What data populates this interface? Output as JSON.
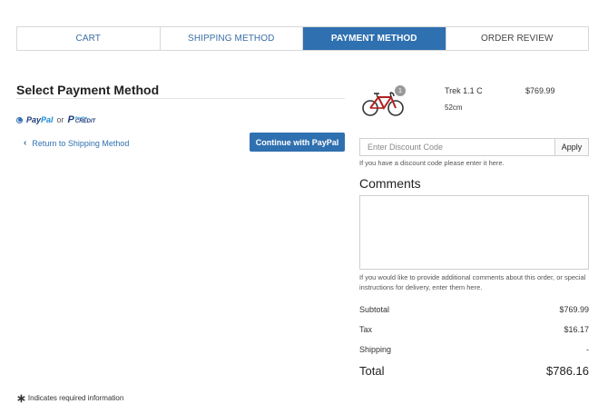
{
  "steps": [
    {
      "label": "CART",
      "active": false
    },
    {
      "label": "SHIPPING METHOD",
      "active": false
    },
    {
      "label": "PAYMENT METHOD",
      "active": true
    },
    {
      "label": "ORDER REVIEW",
      "active": false
    }
  ],
  "payment": {
    "title": "Select Payment Method",
    "option_paypal_pay": "Pay",
    "option_paypal_pal": "Pal",
    "or_text": "or",
    "credit_top": "PayPal",
    "credit_bottom": "CREDIT",
    "return_label": "Return to Shipping Method",
    "continue_label": "Continue with PayPal"
  },
  "required_note": "Indicates required information",
  "cart_item": {
    "quantity": "1",
    "name": "Trek 1.1 C",
    "variant": "52cm",
    "price": "$769.99",
    "image_icon": "bicycle-icon"
  },
  "discount": {
    "placeholder": "Enter Discount Code",
    "value": "",
    "apply_label": "Apply",
    "help": "If you have a discount code please enter it here."
  },
  "comments": {
    "title": "Comments",
    "value": "",
    "help": "If you would like to provide additional comments about this order, or special instructions for delivery, enter them here."
  },
  "summary": {
    "subtotal_label": "Subtotal",
    "subtotal_value": "$769.99",
    "tax_label": "Tax",
    "tax_value": "$16.17",
    "shipping_label": "Shipping",
    "shipping_value": "-",
    "total_label": "Total",
    "total_value": "$786.16"
  },
  "colors": {
    "accent": "#2f70b0",
    "link": "#3a6ea5",
    "paypal_dark": "#1d3b7a",
    "paypal_light": "#1a8ad4"
  }
}
